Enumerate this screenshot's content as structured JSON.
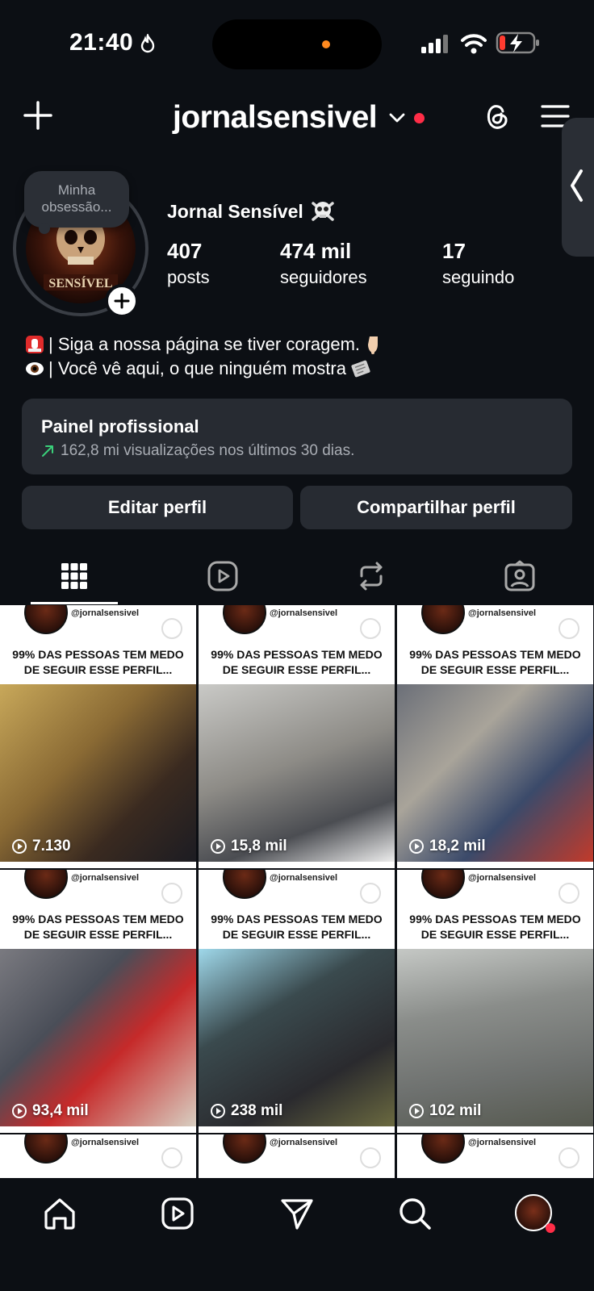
{
  "status": {
    "time": "21:40"
  },
  "header": {
    "username": "jornalsensivel"
  },
  "note": {
    "text": "Minha obsessão..."
  },
  "profile": {
    "display_name": "Jornal Sensível",
    "stats": [
      {
        "value": "407",
        "label": "posts"
      },
      {
        "value": "474 mil",
        "label": "seguidores"
      },
      {
        "value": "17",
        "label": "seguindo"
      }
    ],
    "bio": [
      "| Siga a nossa página se tiver coragem.",
      "| Você vê aqui, o que ninguém mostra"
    ]
  },
  "pro_panel": {
    "title": "Painel profissional",
    "subtitle": "162,8 mi visualizações nos últimos 30 dias."
  },
  "buttons": {
    "edit": "Editar perfil",
    "share": "Compartilhar perfil"
  },
  "posts": {
    "handle": "@jornalsensivel",
    "headline_line1": "99% DAS PESSOAS TEM MEDO",
    "headline_line2": "DE SEGUIR ESSE PERFIL...",
    "views": [
      "7.130",
      "15,8 mil",
      "18,2 mil",
      "93,4 mil",
      "238 mil",
      "102 mil"
    ]
  },
  "colors": {
    "background": "#0c0f14",
    "panel": "#272b32",
    "accent_red": "#ff2d47",
    "trend_green": "#3ad07a"
  }
}
